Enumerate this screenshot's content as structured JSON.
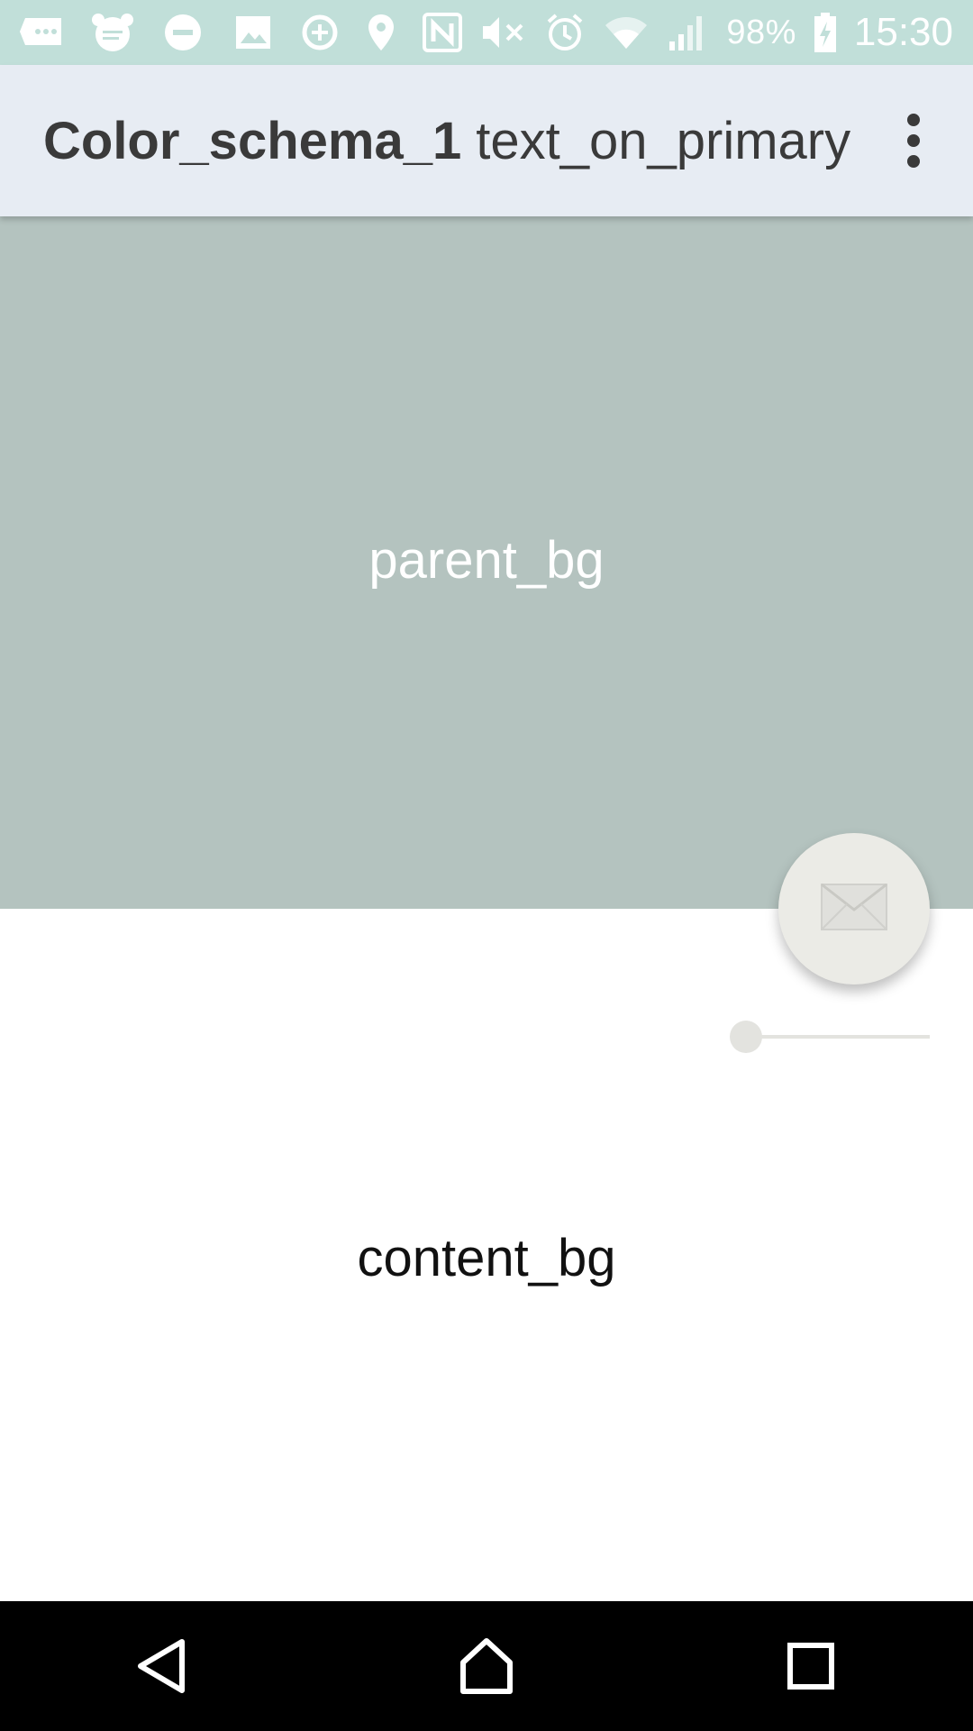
{
  "status_bar": {
    "battery_text": "98%",
    "time": "15:30",
    "icons_left": [
      "chat-bubble-icon",
      "app-notification-icon",
      "do-not-disturb-icon",
      "image-icon"
    ],
    "icons_right": [
      "data-saver-icon",
      "location-icon",
      "nfc-icon",
      "mute-icon",
      "alarm-icon",
      "wifi-icon",
      "signal-icon",
      "battery-charging-icon"
    ]
  },
  "toolbar": {
    "title_bold": "Color_schema_1",
    "title_rest": "text_on_primary",
    "overflow_icon": "more-vert-icon"
  },
  "parent": {
    "label": "parent_bg"
  },
  "content": {
    "label": "content_bg"
  },
  "fab": {
    "icon": "mail-icon"
  },
  "slider": {
    "value": 0
  },
  "nav": {
    "back_icon": "back-icon",
    "home_icon": "home-icon",
    "recents_icon": "recents-icon"
  },
  "colors": {
    "status_bar": "#c1dfd9",
    "toolbar": "#e7ecf3",
    "parent_bg": "#b4c3bf",
    "content_bg": "#ffffff",
    "fab": "#ebebe6",
    "nav_bar": "#000000"
  }
}
